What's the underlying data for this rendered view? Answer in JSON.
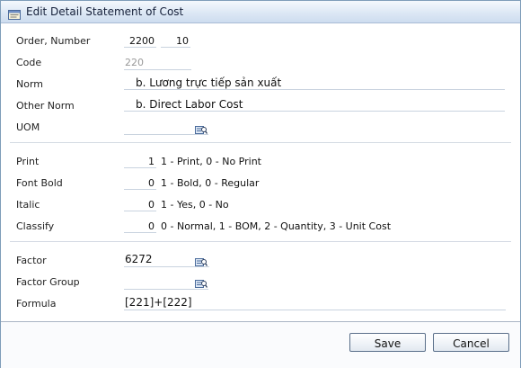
{
  "dialog": {
    "title": "Edit Detail Statement of Cost"
  },
  "fields": {
    "order_number": {
      "label": "Order, Number",
      "order": "2200",
      "number": "10"
    },
    "code": {
      "label": "Code",
      "value": "220"
    },
    "norm": {
      "label": "Norm",
      "value": "b. Lương trực tiếp sản xuất"
    },
    "other_norm": {
      "label": "Other Norm",
      "value": "b. Direct Labor Cost"
    },
    "uom": {
      "label": "UOM",
      "value": ""
    },
    "print": {
      "label": "Print",
      "value": "1",
      "hint": "1 - Print, 0 - No Print"
    },
    "font_bold": {
      "label": "Font Bold",
      "value": "0",
      "hint": "1 - Bold, 0 - Regular"
    },
    "italic": {
      "label": "Italic",
      "value": "0",
      "hint": "1 - Yes, 0 - No"
    },
    "classify": {
      "label": "Classify",
      "value": "0",
      "hint": "0 - Normal, 1 - BOM, 2 - Quantity, 3 - Unit Cost"
    },
    "factor": {
      "label": "Factor",
      "value": "6272"
    },
    "factor_group": {
      "label": "Factor Group",
      "value": ""
    },
    "formula": {
      "label": "Formula",
      "value": "[221]+[222]"
    }
  },
  "buttons": {
    "save": "Save",
    "cancel": "Cancel"
  },
  "icons": {
    "title": "form-icon",
    "lookup": "lookup-icon"
  },
  "colors": {
    "title_bar": "#dde8f5",
    "border": "#7f9db9",
    "field_line": "#c9d3df",
    "button_border": "#5a6f8a"
  }
}
